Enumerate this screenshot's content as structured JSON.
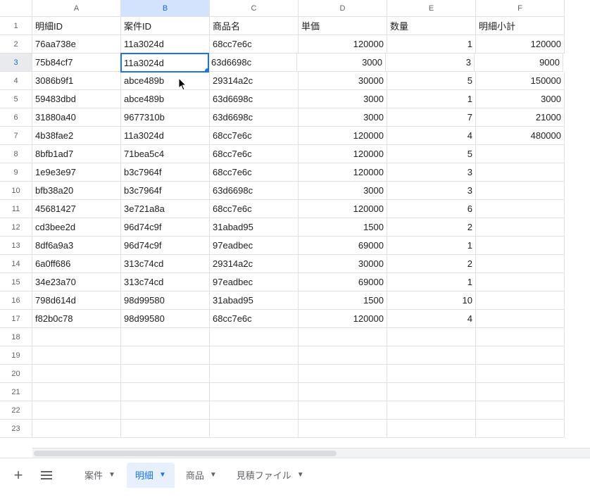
{
  "columns": [
    "A",
    "B",
    "C",
    "D",
    "E",
    "F"
  ],
  "selected_cell": {
    "row": 3,
    "col": "B"
  },
  "headers": {
    "A": "明細ID",
    "B": "案件ID",
    "C": "商品名",
    "D": "単価",
    "E": "数量",
    "F": "明細小計"
  },
  "rows": [
    {
      "A": "76aa738e",
      "B": "11a3024d",
      "C": "68cc7e6c",
      "D": "120000",
      "E": "1",
      "F": "120000"
    },
    {
      "A": "75b84cf7",
      "B": "11a3024d",
      "C": "63d6698c",
      "D": "3000",
      "E": "3",
      "F": "9000"
    },
    {
      "A": "3086b9f1",
      "B": "abce489b",
      "C": "29314a2c",
      "D": "30000",
      "E": "5",
      "F": "150000"
    },
    {
      "A": "59483dbd",
      "B": "abce489b",
      "C": "63d6698c",
      "D": "3000",
      "E": "1",
      "F": "3000"
    },
    {
      "A": "31880a40",
      "B": "9677310b",
      "C": "63d6698c",
      "D": "3000",
      "E": "7",
      "F": "21000"
    },
    {
      "A": "4b38fae2",
      "B": "11a3024d",
      "C": "68cc7e6c",
      "D": "120000",
      "E": "4",
      "F": "480000"
    },
    {
      "A": "8bfb1ad7",
      "B": "71bea5c4",
      "C": "68cc7e6c",
      "D": "120000",
      "E": "5",
      "F": ""
    },
    {
      "A": "1e9e3e97",
      "B": "b3c7964f",
      "C": "68cc7e6c",
      "D": "120000",
      "E": "3",
      "F": ""
    },
    {
      "A": "bfb38a20",
      "B": "b3c7964f",
      "C": "63d6698c",
      "D": "3000",
      "E": "3",
      "F": ""
    },
    {
      "A": "45681427",
      "B": "3e721a8a",
      "C": "68cc7e6c",
      "D": "120000",
      "E": "6",
      "F": ""
    },
    {
      "A": "cd3bee2d",
      "B": "96d74c9f",
      "C": "31abad95",
      "D": "1500",
      "E": "2",
      "F": ""
    },
    {
      "A": "8df6a9a3",
      "B": "96d74c9f",
      "C": "97eadbec",
      "D": "69000",
      "E": "1",
      "F": ""
    },
    {
      "A": "6a0ff686",
      "B": "313c74cd",
      "C": "29314a2c",
      "D": "30000",
      "E": "2",
      "F": ""
    },
    {
      "A": "34e23a70",
      "B": "313c74cd",
      "C": "97eadbec",
      "D": "69000",
      "E": "1",
      "F": ""
    },
    {
      "A": "798d614d",
      "B": "98d99580",
      "C": "31abad95",
      "D": "1500",
      "E": "10",
      "F": ""
    },
    {
      "A": "f82b0c78",
      "B": "98d99580",
      "C": "68cc7e6c",
      "D": "120000",
      "E": "4",
      "F": ""
    }
  ],
  "empty_rows": [
    18,
    19,
    20,
    21,
    22,
    23
  ],
  "tabs": [
    {
      "name": "案件",
      "active": false
    },
    {
      "name": "明細",
      "active": true
    },
    {
      "name": "商品",
      "active": false
    },
    {
      "name": "見積ファイル",
      "active": false
    }
  ]
}
